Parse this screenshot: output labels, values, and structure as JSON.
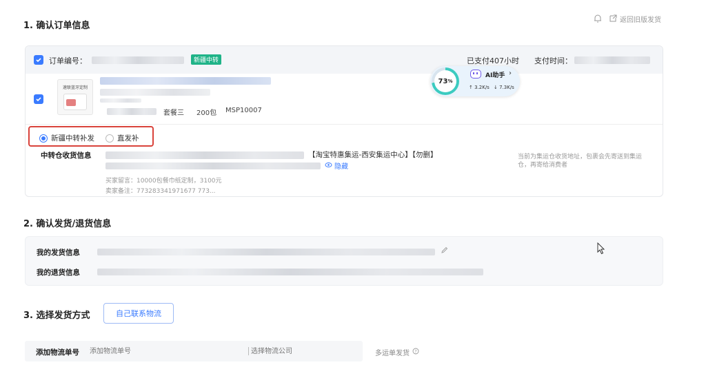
{
  "top_actions": {
    "back_label": "返回旧版发货"
  },
  "section1": {
    "title": "1. 确认订单信息"
  },
  "order": {
    "order_no_label": "订单编号：",
    "transit_tag": "新疆中转",
    "paid_status": "已支付407小时",
    "pay_time_label": "支付时间："
  },
  "product": {
    "thumb_caption": "速联蓝牙定制",
    "variant": "套餐三",
    "quantity": "200包",
    "sku": "MSP10007"
  },
  "ai_widget": {
    "percent": "73",
    "percent_unit": "%",
    "label": "AI助手",
    "up": "3.2K/s",
    "down": "7.3K/s"
  },
  "shipping_mode": {
    "option1": "新疆中转补发",
    "option2": "直发补"
  },
  "transit": {
    "label": "中转仓收货信息",
    "warehouse": "【淘宝特惠集运-西安集运中心】【勿删】",
    "hide_label": "隐藏",
    "buyer_note": "买家留言：10000包餐巾纸定制，3100元",
    "seller_note": "卖家备注：773283341971677 773...",
    "hint": "当前为集运仓收货地址，包裹会先寄送到集运仓，再寄给消费者"
  },
  "section2": {
    "title": "2. 确认发货/退货信息"
  },
  "addresses": {
    "ship_label": "我的发货信息",
    "return_label": "我的退货信息"
  },
  "section3": {
    "title": "3. 选择发货方式",
    "self_logistics": "自己联系物流"
  },
  "logistics": {
    "label": "添加物流单号",
    "tracking_placeholder": "添加物流单号",
    "company_placeholder": "选择物流公司",
    "multi_label": "多运单发货"
  }
}
